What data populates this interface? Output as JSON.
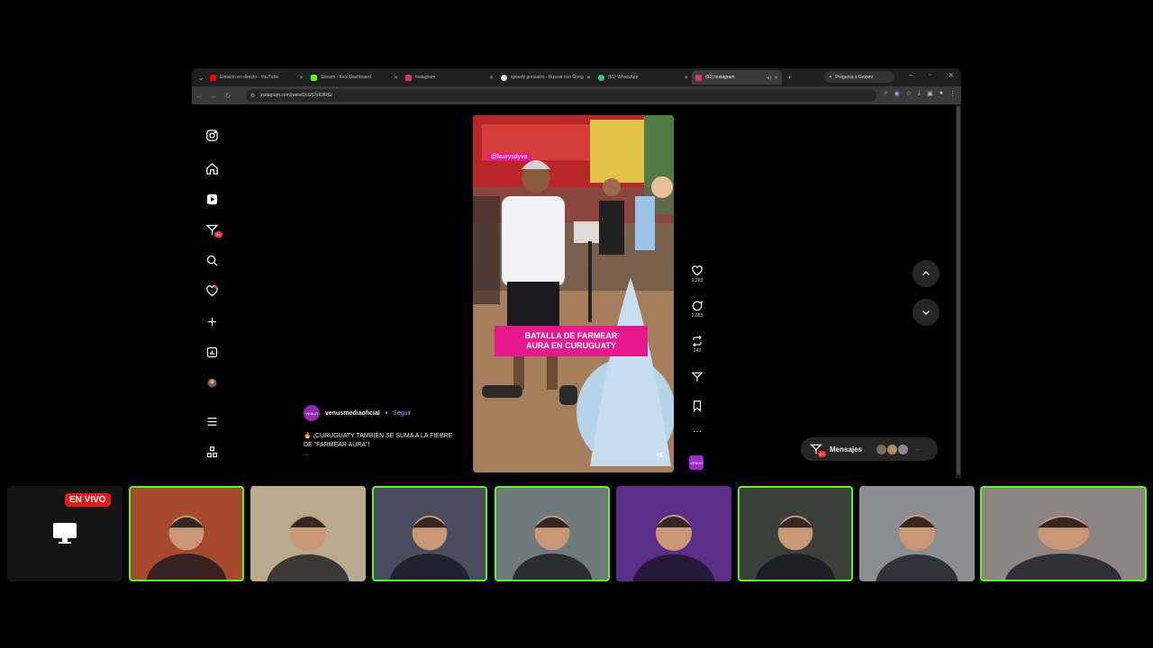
{
  "browser": {
    "tabs": [
      {
        "label": "Emisión en directo - YouTube",
        "color": "#ff0000"
      },
      {
        "label": "Stream - Kick Dashboard",
        "color": "#53fc18"
      },
      {
        "label": "Instagram",
        "color": "#e1306c"
      },
      {
        "label": "speedy gonzales - Buscar con Google",
        "color": "#ffffff"
      },
      {
        "label": "(65) WhatsApp",
        "color": "#25d366"
      },
      {
        "label": "(31) Instagram",
        "color": "#e1306c",
        "active": true
      }
    ],
    "gemini_label": "Pregunta a Gemini",
    "url": "instagram.com/reels/DcG52xIOIRG/"
  },
  "sidebar": {
    "notification_badge": "9+",
    "items": [
      "instagram-logo-icon",
      "home-icon",
      "reels-icon",
      "direct-messages-icon",
      "search-icon",
      "notifications-icon",
      "create-icon",
      "dashboard-icon",
      "profile-avatar",
      "more-menu-icon",
      "meta-apps-icon"
    ]
  },
  "reel": {
    "mention": "@laurysdyva",
    "banner_line1": "BATALLA DE FARMEAR",
    "banner_line2": "AURA EN CURUGUATY",
    "author": "venusmediaoficial",
    "author_avatar_text": "VENUS",
    "separator": "•",
    "follow_label": "Seguir",
    "caption": "🔥 ¡CURUGUATY TAMBIÉN SE SUMA A LA FIEBRE DE \"FARMEAR AURA\"!",
    "caption_more": "...",
    "likes": "9.283",
    "comments": "2.683",
    "reposts": "243",
    "audio_label": "VENUS"
  },
  "messages": {
    "label": "Mensajes",
    "badge": "9+"
  },
  "stream": {
    "live_label": "EN VIVO",
    "participants": [
      {
        "bg": "#a54a2c",
        "speaking": true
      },
      {
        "bg": "#b9a98d",
        "speaking": false
      },
      {
        "bg": "#4a4d5e",
        "speaking": true
      },
      {
        "bg": "#6f7a7c",
        "speaking": true
      },
      {
        "bg": "#5b2f87",
        "speaking": false
      },
      {
        "bg": "#39403a",
        "speaking": true
      },
      {
        "bg": "#8a8e90",
        "speaking": false
      },
      {
        "bg": "#8d8484",
        "speaking": true
      }
    ]
  }
}
